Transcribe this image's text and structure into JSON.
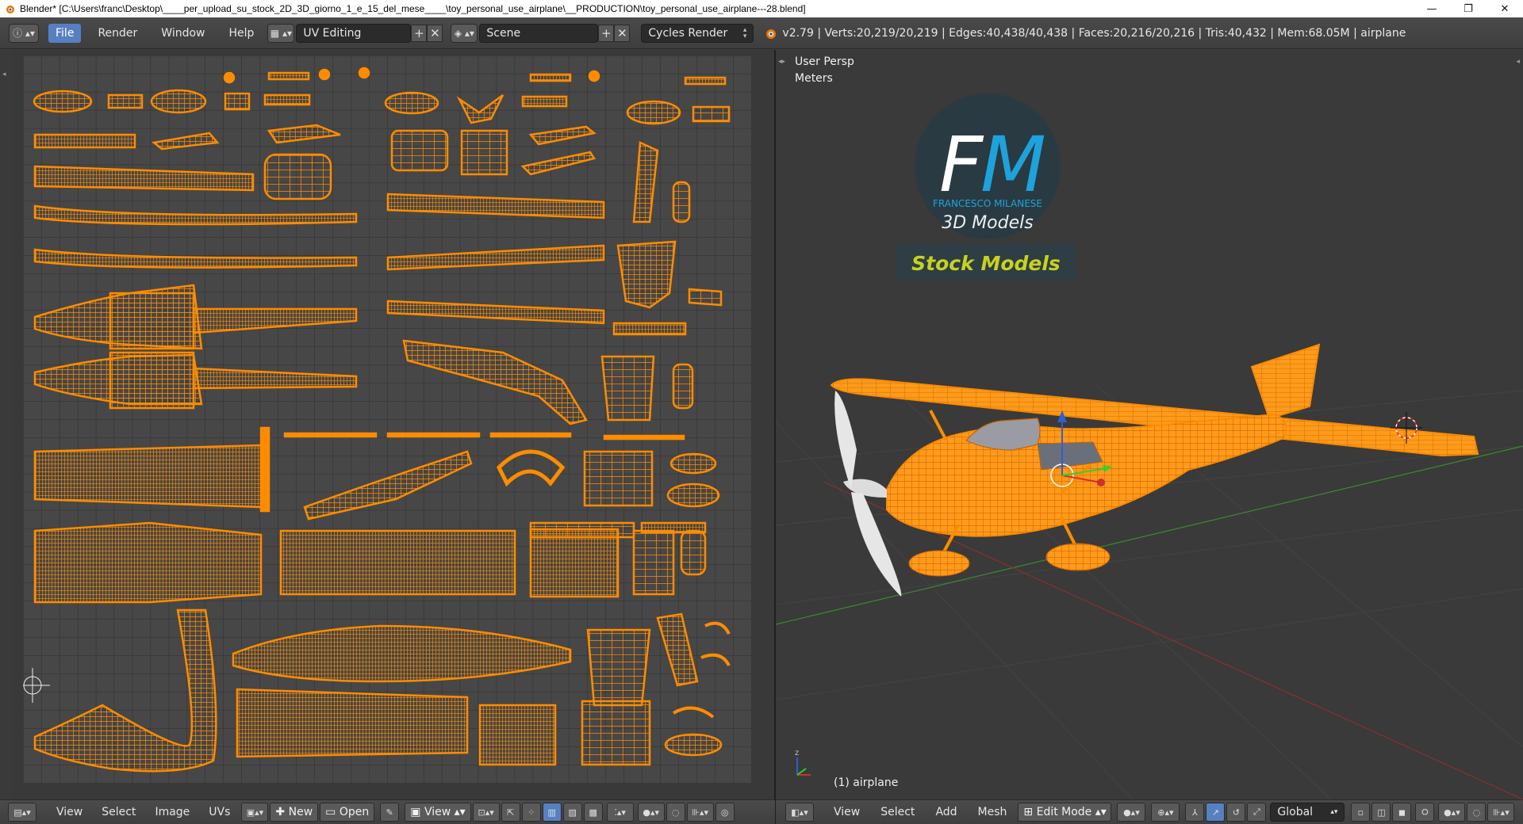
{
  "window": {
    "title": "Blender* [C:\\Users\\franc\\Desktop\\____per_upload_su_stock_2D_3D_giorno_1_e_15_del_mese____\\toy_personal_use_airplane\\__PRODUCTION\\toy_personal_use_airplane---28.blend]",
    "minimize": "—",
    "maximize": "❐",
    "close": "✕"
  },
  "info_header": {
    "menus": [
      "File",
      "Render",
      "Window",
      "Help"
    ],
    "screen_layout": "UV Editing",
    "scene": "Scene",
    "render_engine": "Cycles Render",
    "stats": "v2.79 | Verts:20,219/20,219 | Edges:40,438/40,438 | Faces:20,216/20,216 | Tris:40,432 | Mem:68.05M | airplane"
  },
  "uv_editor": {
    "footer": {
      "menus": [
        "View",
        "Select",
        "Image",
        "UVs"
      ],
      "new_label": "New",
      "open_label": "Open",
      "view_label": "View"
    }
  },
  "viewport": {
    "view_name": "User Persp",
    "units": "Meters",
    "object_label": "(1) airplane",
    "logo": {
      "initials_f": "F",
      "initials_m": "M",
      "company": "FRANCESCO MILANESE",
      "subtitle": "3D Models",
      "banner": "Stock Models"
    },
    "footer": {
      "menus": [
        "View",
        "Select",
        "Add",
        "Mesh"
      ],
      "mode": "Edit Mode",
      "orientation": "Global"
    }
  },
  "colors": {
    "uv_orange": "#ff8c00",
    "header_bg": "#454545",
    "selected_blue": "#5680c2",
    "logo_cyan": "#1da3dc",
    "logo_yellow": "#c8d21e"
  }
}
